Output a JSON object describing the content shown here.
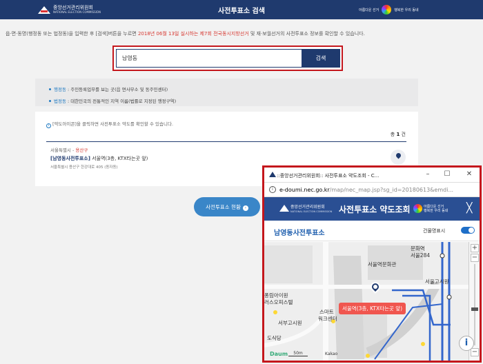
{
  "header": {
    "logo_text": "중앙선거관리위원회",
    "logo_sub": "NATIONAL ELECTION COMMISSION",
    "title": "사전투표소 검색",
    "slogan_a": "아름다운 선거",
    "slogan_b": "행복한 우리 동네"
  },
  "description": {
    "part1": "읍·면·동명(행정동 또는 법정동)을 입력한 후 [검색]버튼을 누르면 ",
    "highlight": "2018년 06월 13일 실시하는 제7회 전국동시지방선거",
    "part2": " 및 재·보궐선거의 사전투표소 정보를 확인할 수 있습니다."
  },
  "search": {
    "value": "남영동",
    "button_label": "검색"
  },
  "info": {
    "items": [
      {
        "key": "행정동",
        "text": " : 주민등록업무를 보는 곳(읍 면사무소 및 동주민센터)"
      },
      {
        "key": "법정동",
        "text": " : 대한민국의 전통적인 지역 이름(법률로 지정된 행정구역)"
      }
    ]
  },
  "results": {
    "hint_icon": "i",
    "hint": "[약도아이콘]을 클릭하면 사전투표소 약도를 확인할 수 있습니다.",
    "count_prefix": "총 ",
    "count": "1",
    "count_suffix": " 건",
    "rows": [
      {
        "area_prefix": "서울특별시 - ",
        "area_highlight": "용산구",
        "name": "[남영동사전투표소]",
        "place": " 서울역(3층, KTX타는곳 앞)",
        "address": "서울특별시 용산구 한강대로 405 (동자동)"
      }
    ]
  },
  "status_button": {
    "label": "사전투표소 현황",
    "chevron": "›"
  },
  "popup": {
    "window_title": "::중앙선거관리위원회:: 사전투표소 약도조회 - C...",
    "url_domain": "e-doumi.nec.go.kr",
    "url_rest": "/map/nec_map.jsp?sg_id=20180613&emdi...",
    "logo_text": "중앙선거관리위원회",
    "logo_sub": "NATIONAL ELECTION COMMISSION",
    "page_title": "사전투표소 약도조회",
    "slogan_a": "아름다운 선거",
    "slogan_b": "행복한 우리 동네",
    "close": "╳",
    "station_name": "남영동사전투표소",
    "building_label": "건물명표시",
    "map": {
      "labels": {
        "l1": "문화역",
        "l2": "서울284",
        "l3": "서울역문화관",
        "l4": "서울고시원",
        "l5": "퐁림아이원",
        "l6": "러스오피스텔",
        "l7": "스마트",
        "l8": "워크센터",
        "l9": "서부고시원",
        "l10": "도식당"
      },
      "bubble": "서울역(3층, KTX타는곳 앞)",
      "logo": "Daum",
      "scale": "50m",
      "attribution": "Kakao"
    }
  },
  "colors": {
    "header_navy": "#1f3a6e",
    "highlight_red": "#d6362f",
    "frame_red": "#c4161c",
    "button_blue": "#3a86c8",
    "link_blue": "#1f7ac2"
  }
}
